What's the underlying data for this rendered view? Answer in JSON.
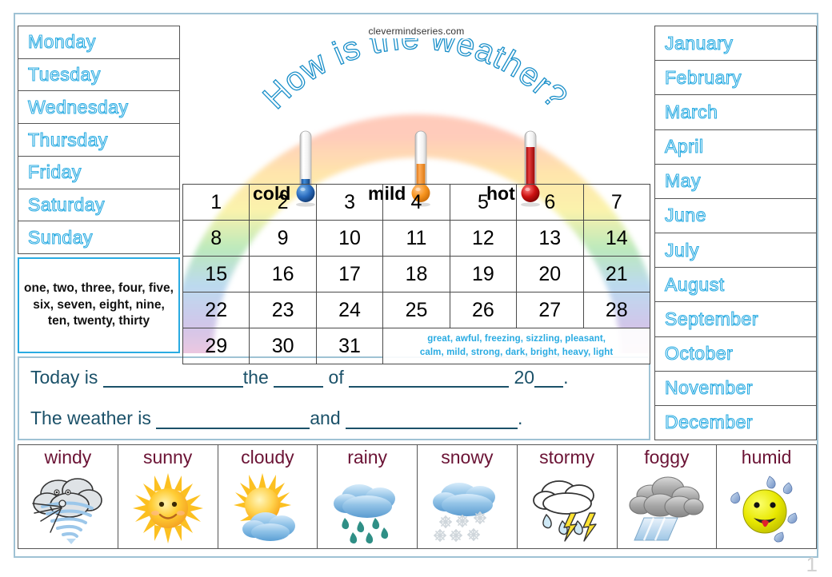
{
  "watermark": "clevermindseries.com",
  "title": "How is the weather?",
  "page_number": "1",
  "colors": {
    "outline_blue": "#29ABE2",
    "frame_blue": "#9fc2d4",
    "sentence_navy": "#1b5169",
    "weather_label_maroon": "#6b1335",
    "cold": "#2060b0",
    "mild": "#F7941E",
    "hot": "#CC1111"
  },
  "weekdays": [
    "Monday",
    "Tuesday",
    "Wednesday",
    "Thursday",
    "Friday",
    "Saturday",
    "Sunday"
  ],
  "months": [
    "January",
    "February",
    "March",
    "April",
    "May",
    "June",
    "July",
    "August",
    "September",
    "October",
    "November",
    "December"
  ],
  "number_words": "one, two, three, four, five, six, seven, eight, nine, ten, twenty, thirty",
  "thermometers": [
    {
      "label": "cold",
      "level": 12
    },
    {
      "label": "mild",
      "level": 44
    },
    {
      "label": "hot",
      "level": 72
    }
  ],
  "calendar": {
    "rows": [
      [
        "1",
        "2",
        "3",
        "4",
        "5",
        "6",
        "7"
      ],
      [
        "8",
        "9",
        "10",
        "11",
        "12",
        "13",
        "14"
      ],
      [
        "15",
        "16",
        "17",
        "18",
        "19",
        "20",
        "21"
      ],
      [
        "22",
        "23",
        "24",
        "25",
        "26",
        "27",
        "28"
      ],
      [
        "29",
        "30",
        "31"
      ]
    ],
    "adjectives_line1": "great, awful, freezing, sizzling, pleasant,",
    "adjectives_line2": "calm, mild, strong, dark, bright,  heavy, light"
  },
  "sentences": {
    "line1_part1": "Today is",
    "line1_part2": "the",
    "line1_part3": "of",
    "line1_part4": "20",
    "line1_part5": ".",
    "line2_part1": "The weather is",
    "line2_part2": "and",
    "line2_part3": "."
  },
  "weather": [
    {
      "label": "windy",
      "icon": "windy-icon"
    },
    {
      "label": "sunny",
      "icon": "sunny-icon"
    },
    {
      "label": "cloudy",
      "icon": "cloudy-icon"
    },
    {
      "label": "rainy",
      "icon": "rainy-icon"
    },
    {
      "label": "snowy",
      "icon": "snowy-icon"
    },
    {
      "label": "stormy",
      "icon": "stormy-icon"
    },
    {
      "label": "foggy",
      "icon": "foggy-icon"
    },
    {
      "label": "humid",
      "icon": "humid-icon"
    }
  ]
}
